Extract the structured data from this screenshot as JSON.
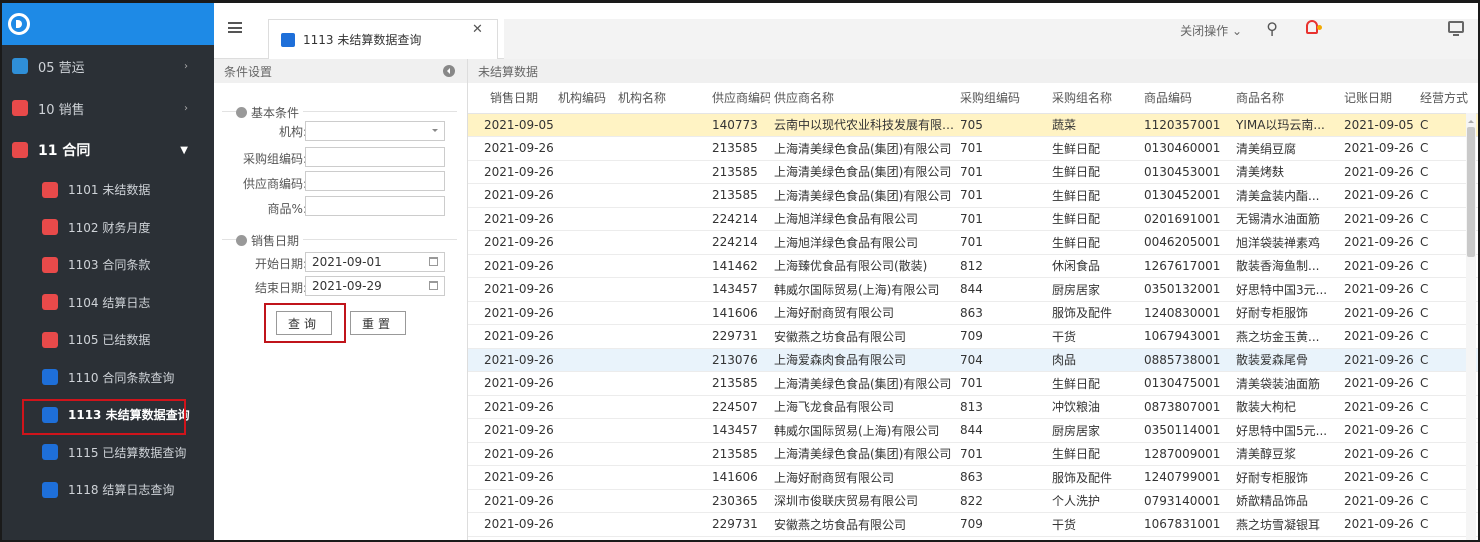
{
  "sidebar": {
    "items": [
      {
        "label": "05 营运",
        "icon": "monitor-icon",
        "color": "#2f8fd8"
      },
      {
        "label": "10 销售",
        "icon": "shop-icon",
        "color": "#e84a4a"
      },
      {
        "label": "11 合同",
        "icon": "contract-icon",
        "color": "#e84a4a"
      }
    ],
    "sub_items": [
      {
        "label": "1101 未结数据",
        "icon": "circle-icon",
        "color": "#e84a4a"
      },
      {
        "label": "1102 财务月度",
        "icon": "search-icon",
        "color": "#e84a4a"
      },
      {
        "label": "1103 合同条款",
        "icon": "document-icon",
        "color": "#e84a4a"
      },
      {
        "label": "1104 结算日志",
        "icon": "circle-icon",
        "color": "#e84a4a"
      },
      {
        "label": "1105 已结数据",
        "icon": "search-icon",
        "color": "#e84a4a"
      },
      {
        "label": "1110 合同条款查询",
        "icon": "form-icon",
        "color": "#1e6fd9"
      },
      {
        "label": "1113 未结算数据查询",
        "icon": "form-icon",
        "color": "#1e6fd9"
      },
      {
        "label": "1115 已结算数据查询",
        "icon": "form-icon",
        "color": "#1e6fd9"
      },
      {
        "label": "1118 结算日志查询",
        "icon": "form-icon",
        "color": "#1e6fd9"
      }
    ]
  },
  "header": {
    "tab_label": "1113 未结算数据查询",
    "close_ops": "关闭操作 ⌄"
  },
  "conditions": {
    "title": "条件设置",
    "basic_group": "基本条件",
    "org_label": "机构:",
    "purchase_group_label": "采购组编码:",
    "supplier_label": "供应商编码:",
    "product_label": "商品%:",
    "date_group": "销售日期",
    "start_label": "开始日期:",
    "start_value": "2021-09-01",
    "end_label": "结束日期:",
    "end_value": "2021-09-29",
    "query_button": "查询",
    "reset_button": "重置"
  },
  "data_panel": {
    "title": "未结算数据",
    "columns": [
      "销售日期",
      "机构编码",
      "机构名称",
      "供应商编码",
      "供应商名称",
      "采购组编码",
      "采购组名称",
      "商品编码",
      "商品名称",
      "记账日期",
      "经营方式"
    ],
    "rows": [
      [
        "2021-09-05",
        "",
        "",
        "140773",
        "云南中以现代农业科技发展有限公...",
        "705",
        "蔬菜",
        "1120357001",
        "YIMA以玛云南...",
        "2021-09-05",
        "C"
      ],
      [
        "2021-09-26",
        "",
        "",
        "213585",
        "上海清美绿色食品(集团)有限公司",
        "701",
        "生鲜日配",
        "0130460001",
        "清美绢豆腐",
        "2021-09-26",
        "C"
      ],
      [
        "2021-09-26",
        "",
        "",
        "213585",
        "上海清美绿色食品(集团)有限公司",
        "701",
        "生鲜日配",
        "0130453001",
        "清美烤麸",
        "2021-09-26",
        "C"
      ],
      [
        "2021-09-26",
        "",
        "",
        "213585",
        "上海清美绿色食品(集团)有限公司",
        "701",
        "生鲜日配",
        "0130452001",
        "清美盒装内酯...",
        "2021-09-26",
        "C"
      ],
      [
        "2021-09-26",
        "",
        "",
        "224214",
        "上海旭洋绿色食品有限公司",
        "701",
        "生鲜日配",
        "0201691001",
        "无锡清水油面筋",
        "2021-09-26",
        "C"
      ],
      [
        "2021-09-26",
        "",
        "",
        "224214",
        "上海旭洋绿色食品有限公司",
        "701",
        "生鲜日配",
        "0046205001",
        "旭洋袋装禅素鸡",
        "2021-09-26",
        "C"
      ],
      [
        "2021-09-26",
        "",
        "",
        "141462",
        "上海臻优食品有限公司(散装)",
        "812",
        "休闲食品",
        "1267617001",
        "散装香海鱼制...",
        "2021-09-26",
        "C"
      ],
      [
        "2021-09-26",
        "",
        "",
        "143457",
        "韩威尔国际贸易(上海)有限公司",
        "844",
        "厨房居家",
        "0350132001",
        "好思特中国3元...",
        "2021-09-26",
        "C"
      ],
      [
        "2021-09-26",
        "",
        "",
        "141606",
        "上海好耐商贸有限公司",
        "863",
        "服饰及配件",
        "1240830001",
        "好耐专柜服饰",
        "2021-09-26",
        "C"
      ],
      [
        "2021-09-26",
        "",
        "",
        "229731",
        "安徽燕之坊食品有限公司",
        "709",
        "干货",
        "1067943001",
        "燕之坊金玉黄...",
        "2021-09-26",
        "C"
      ],
      [
        "2021-09-26",
        "",
        "",
        "213076",
        "上海爱森肉食品有限公司",
        "704",
        "肉品",
        "0885738001",
        "散装爱森尾骨",
        "2021-09-26",
        "C"
      ],
      [
        "2021-09-26",
        "",
        "",
        "213585",
        "上海清美绿色食品(集团)有限公司",
        "701",
        "生鲜日配",
        "0130475001",
        "清美袋装油面筋",
        "2021-09-26",
        "C"
      ],
      [
        "2021-09-26",
        "",
        "",
        "224507",
        "上海飞龙食品有限公司",
        "813",
        "冲饮粮油",
        "0873807001",
        "散装大枸杞",
        "2021-09-26",
        "C"
      ],
      [
        "2021-09-26",
        "",
        "",
        "143457",
        "韩威尔国际贸易(上海)有限公司",
        "844",
        "厨房居家",
        "0350114001",
        "好思特中国5元...",
        "2021-09-26",
        "C"
      ],
      [
        "2021-09-26",
        "",
        "",
        "213585",
        "上海清美绿色食品(集团)有限公司",
        "701",
        "生鲜日配",
        "1287009001",
        "清美醇豆浆",
        "2021-09-26",
        "C"
      ],
      [
        "2021-09-26",
        "",
        "",
        "141606",
        "上海好耐商贸有限公司",
        "863",
        "服饰及配件",
        "1240799001",
        "好耐专柜服饰",
        "2021-09-26",
        "C"
      ],
      [
        "2021-09-26",
        "",
        "",
        "230365",
        "深圳市俊联庆贸易有限公司",
        "822",
        "个人洗护",
        "0793140001",
        "娇歆精品饰品",
        "2021-09-26",
        "C"
      ],
      [
        "2021-09-26",
        "",
        "",
        "229731",
        "安徽燕之坊食品有限公司",
        "709",
        "干货",
        "1067831001",
        "燕之坊雪凝银耳",
        "2021-09-26",
        "C"
      ]
    ],
    "selected_row": 0,
    "hovered_row": 10
  }
}
